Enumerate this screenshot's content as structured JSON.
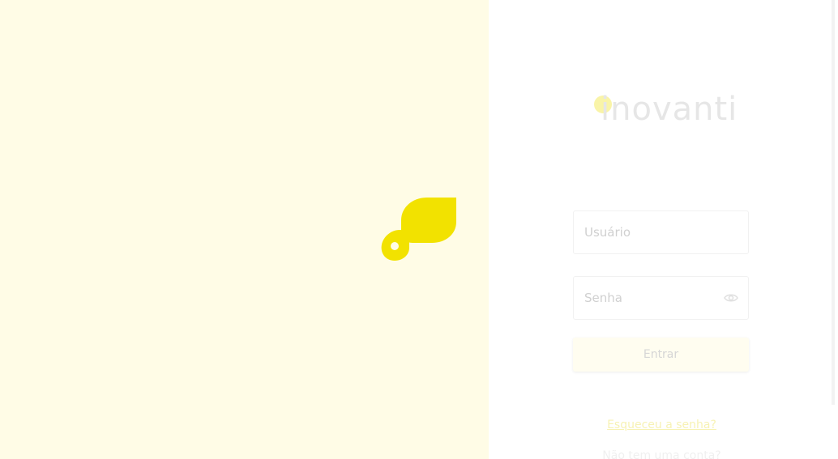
{
  "brand": {
    "name": "inovanti",
    "accent_color": "#f2e200",
    "background_tint": "#fffce6"
  },
  "login_form": {
    "username_label": "Usuário",
    "password_label": "Senha",
    "submit_label": "Entrar",
    "password_toggle_icon": "eye-icon"
  },
  "links": {
    "forgot_password": "Esqueceu a senha?",
    "secondary": "Não tem uma conta?"
  }
}
